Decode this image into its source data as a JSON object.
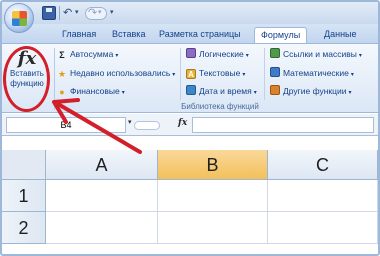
{
  "quick_access": {
    "undo": "↶",
    "redo": "↷",
    "dropdown": "▾",
    "more": "▾"
  },
  "tabs": [
    {
      "label": "Главная"
    },
    {
      "label": "Вставка"
    },
    {
      "label": "Разметка страницы"
    },
    {
      "label": "Формулы",
      "active": true
    },
    {
      "label": "Данные"
    }
  ],
  "ribbon": {
    "insert_function": {
      "glyph": "fx",
      "label_line1": "Вставить",
      "label_line2": "функцию"
    },
    "commands": [
      {
        "label": "Автосумма",
        "icon": "sigma-icon",
        "glyph": "Σ"
      },
      {
        "label": "Недавно использовались",
        "icon": "star-icon",
        "glyph": "★"
      },
      {
        "label": "Финансовые",
        "icon": "coins-icon",
        "glyph": "●"
      },
      {
        "label": "Логические",
        "icon": "book-icon",
        "glyph": ""
      },
      {
        "label": "Текстовые",
        "icon": "text-icon",
        "glyph": "A"
      },
      {
        "label": "Дата и время",
        "icon": "calendar-icon",
        "glyph": ""
      },
      {
        "label": "Ссылки и массивы",
        "icon": "book-icon",
        "glyph": ""
      },
      {
        "label": "Математические",
        "icon": "book-icon",
        "glyph": ""
      },
      {
        "label": "Другие функции",
        "icon": "book-icon",
        "glyph": ""
      }
    ],
    "dropdown": "▾",
    "group_label": "Библиотека функций"
  },
  "formula_bar": {
    "name_box": "B4",
    "fx": "fx",
    "dropdown": "▾",
    "value": ""
  },
  "grid": {
    "columns": [
      "A",
      "B",
      "C"
    ],
    "rows": [
      "1",
      "2"
    ],
    "selected_column": "B"
  },
  "colors": {
    "annotation": "#d21f2a",
    "selected_header": "#f3c05a",
    "ribbon_text": "#15428b"
  }
}
